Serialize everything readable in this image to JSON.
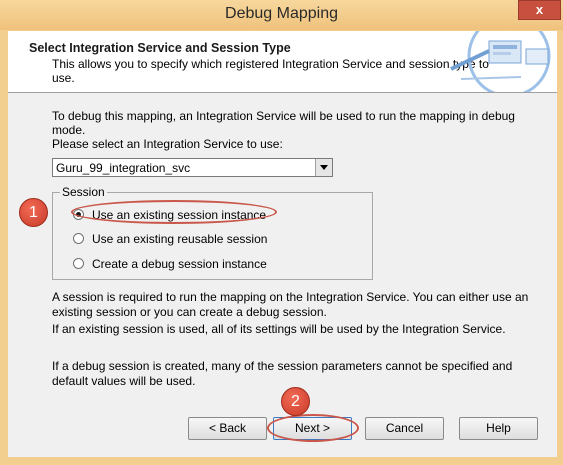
{
  "window": {
    "title": "Debug Mapping",
    "close_label": "x"
  },
  "header": {
    "title": "Select Integration Service and Session Type",
    "description": "This allows you to specify which registered Integration Service and session type to use."
  },
  "intro_text": "To debug this mapping, an Integration Service will be used to run the mapping in debug mode.\nPlease select an Integration Service to use:",
  "service_select": {
    "value": "Guru_99_integration_svc"
  },
  "session": {
    "legend": "Session",
    "options": [
      {
        "label": "Use an existing session instance",
        "selected": true
      },
      {
        "label": "Use an existing reusable session",
        "selected": false
      },
      {
        "label": "Create a debug session instance",
        "selected": false
      }
    ]
  },
  "notes": {
    "required": "A session is required to run the mapping on the Integration Service.  You can either use an existing session or you can create a debug session.",
    "existing": "If an existing session is used, all of its settings will be used by the Integration Service.",
    "debug": "If a debug session is created, many of the session parameters cannot be specified and default values will be used."
  },
  "buttons": {
    "back": "< Back",
    "next": "Next >",
    "cancel": "Cancel",
    "help": "Help"
  },
  "annotations": {
    "marker_1": "1",
    "marker_2": "2"
  },
  "colors": {
    "frame": "#f3cf8f",
    "annotation_red": "#c9574a"
  }
}
